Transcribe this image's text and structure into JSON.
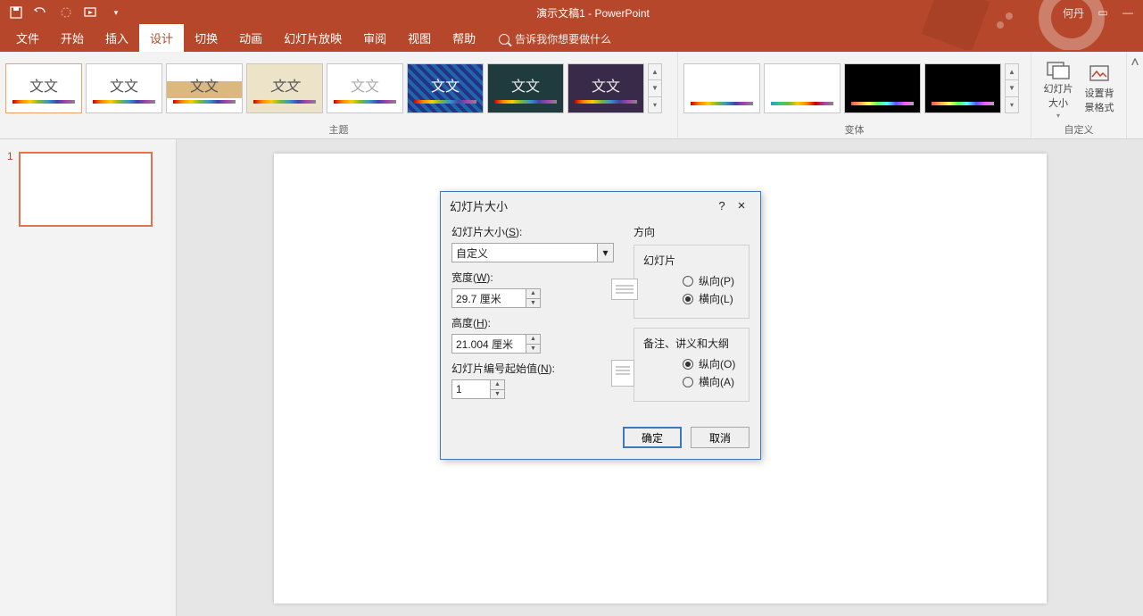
{
  "title": "演示文稿1 - PowerPoint",
  "user": "何丹",
  "tabs": {
    "file": "文件",
    "home": "开始",
    "insert": "插入",
    "design": "设计",
    "transition": "切换",
    "animation": "动画",
    "slideshow": "幻灯片放映",
    "review": "审阅",
    "view": "视图",
    "help": "帮助"
  },
  "tellme": "告诉我你想要做什么",
  "groups": {
    "themes": "主题",
    "variants": "变体",
    "custom": "自定义"
  },
  "theme_text": "文文",
  "custom_btns": {
    "slide_size": "幻灯片大小",
    "format_bg": "设置背景格式"
  },
  "slide_number": "1",
  "dialog": {
    "title": "幻灯片大小",
    "help": "?",
    "close": "×",
    "size_label_pre": "幻灯片大小(",
    "size_label_u": "S",
    "size_label_post": "):",
    "size_value": "自定义",
    "width_label_pre": "宽度(",
    "width_label_u": "W",
    "width_label_post": "):",
    "width_value": "29.7 厘米",
    "height_label_pre": "高度(",
    "height_label_u": "H",
    "height_label_post": "):",
    "height_value": "21.004 厘米",
    "numbering_pre": "幻灯片编号起始值(",
    "numbering_u": "N",
    "numbering_post": "):",
    "numbering_value": "1",
    "orientation_group": "方向",
    "slides_label": "幻灯片",
    "portrait_pre": "纵向(",
    "portrait_u": "P",
    "portrait_post": ")",
    "landscape_pre": "横向(",
    "landscape_u": "L",
    "landscape_post": ")",
    "notes_label": "备注、讲义和大纲",
    "portrait2_pre": "纵向(",
    "portrait2_u": "O",
    "portrait2_post": ")",
    "landscape2_pre": "横向(",
    "landscape2_u": "A",
    "landscape2_post": ")",
    "ok": "确定",
    "cancel": "取消"
  }
}
